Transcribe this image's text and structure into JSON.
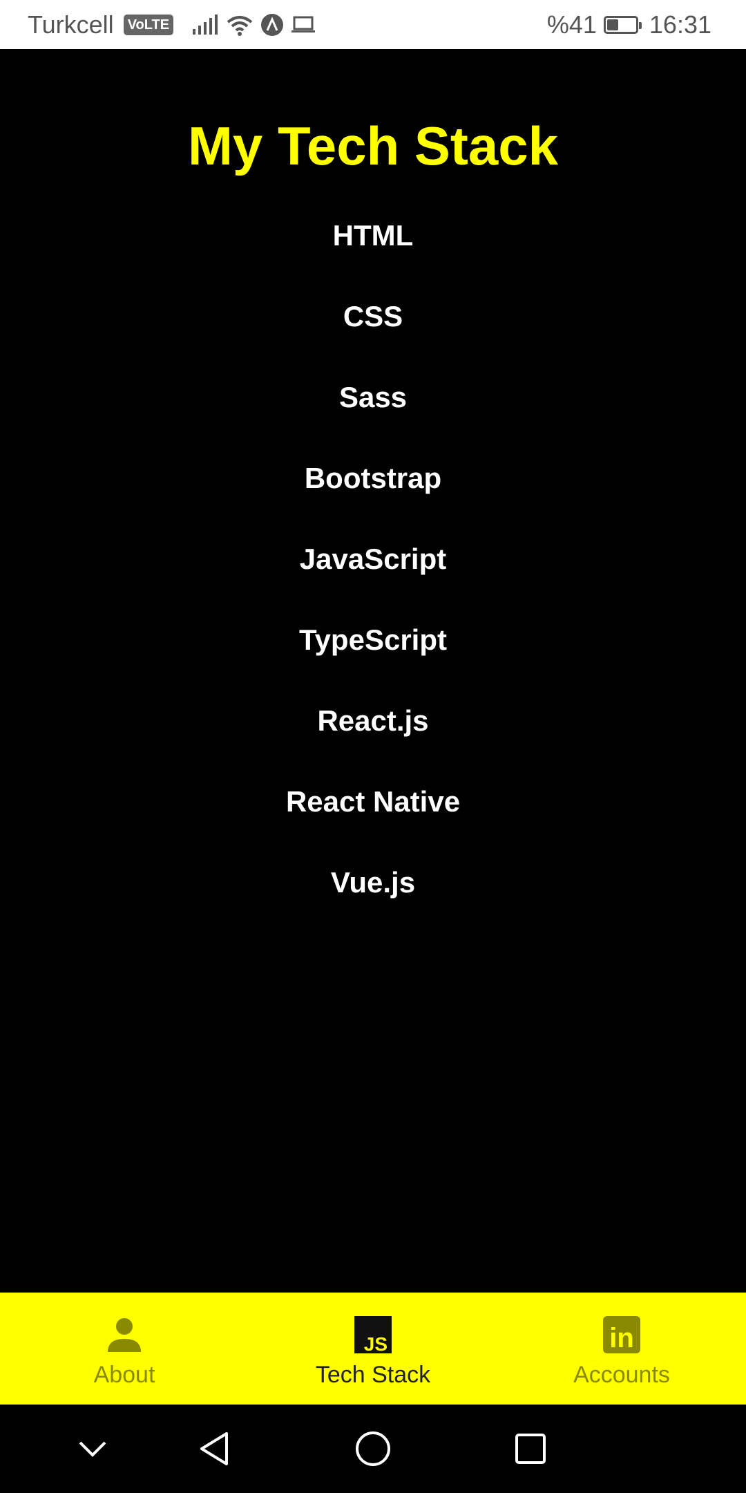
{
  "status_bar": {
    "carrier": "Turkcell",
    "volte": "VoLTE",
    "battery_text": "%41",
    "battery_level": 0.41,
    "time": "16:31",
    "icons": [
      "signal-icon",
      "wifi-icon",
      "app-notification-icon",
      "laptop-icon",
      "battery-icon"
    ]
  },
  "main": {
    "title": "My Tech Stack",
    "title_color": "#ffff00",
    "items": [
      {
        "label": "HTML"
      },
      {
        "label": "CSS"
      },
      {
        "label": "Sass"
      },
      {
        "label": "Bootstrap"
      },
      {
        "label": "JavaScript"
      },
      {
        "label": "TypeScript"
      },
      {
        "label": "React.js"
      },
      {
        "label": "React Native"
      },
      {
        "label": "Vue.js"
      }
    ]
  },
  "tab_bar": {
    "background": "#ffff00",
    "tabs": [
      {
        "label": "About",
        "icon": "person-icon",
        "active": false
      },
      {
        "label": "Tech Stack",
        "icon": "javascript-icon",
        "active": true,
        "icon_text": "JS"
      },
      {
        "label": "Accounts",
        "icon": "linkedin-icon",
        "active": false,
        "icon_text": "in"
      }
    ]
  },
  "nav_bar": {
    "buttons": [
      "chevron-down-icon",
      "back-icon",
      "home-icon",
      "recents-icon"
    ]
  }
}
